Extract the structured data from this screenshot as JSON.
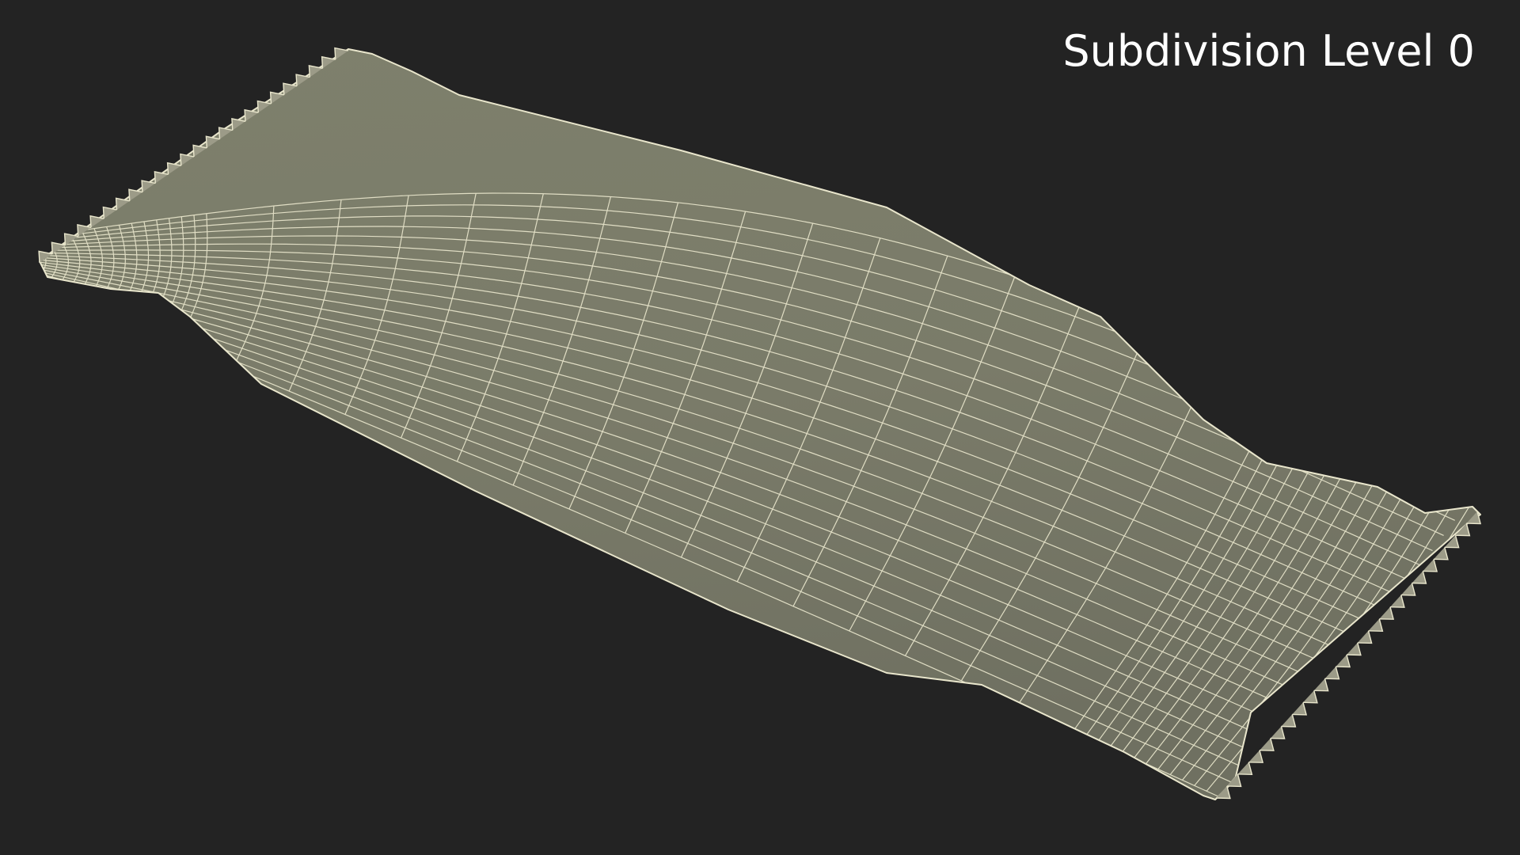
{
  "overlay": {
    "label": "Subdivision Level 0"
  },
  "colors": {
    "background": "#232323",
    "surface": "#7a7b69",
    "wire": "#e9e6cc",
    "label": "#ffffff"
  },
  "subject": {
    "icon": "wrapped-bar-wireframe"
  }
}
